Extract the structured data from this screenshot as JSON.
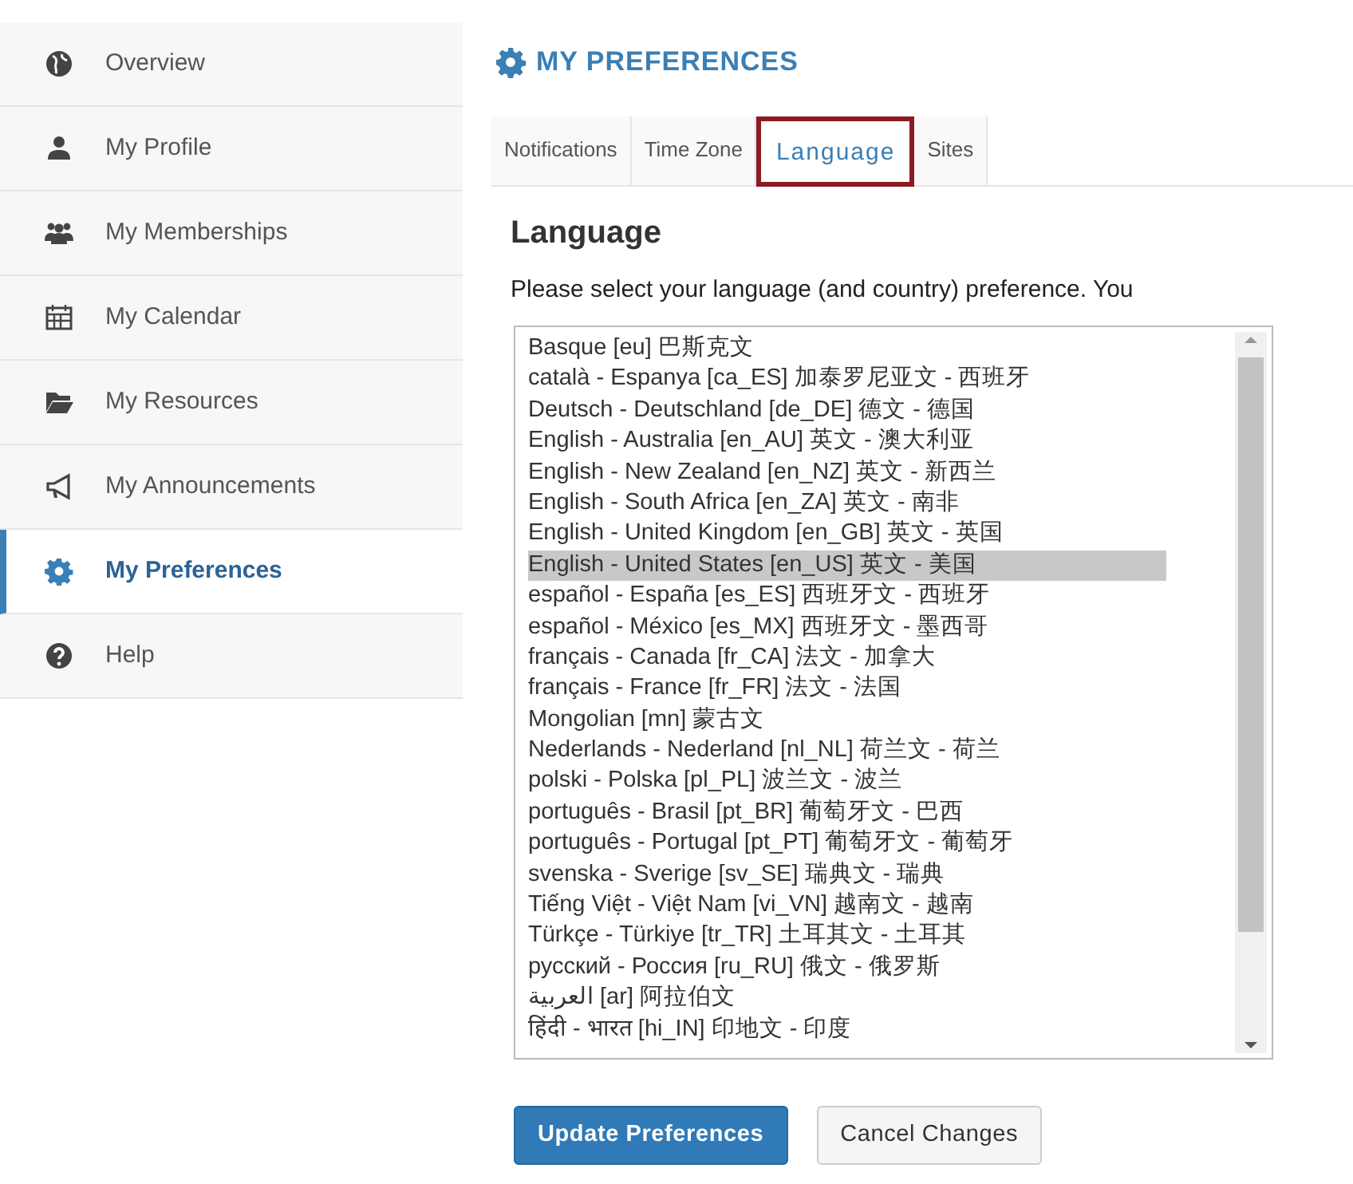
{
  "sidebar": {
    "items": [
      {
        "label": "Overview",
        "kind": "globe",
        "selected": false
      },
      {
        "label": "My Profile",
        "kind": "user",
        "selected": false
      },
      {
        "label": "My Memberships",
        "kind": "users",
        "selected": false
      },
      {
        "label": "My Calendar",
        "kind": "calendar",
        "selected": false
      },
      {
        "label": "My Resources",
        "kind": "folder",
        "selected": false
      },
      {
        "label": "My Announcements",
        "kind": "bullhorn",
        "selected": false
      },
      {
        "label": "My Preferences",
        "kind": "gear",
        "selected": true
      },
      {
        "label": "Help",
        "kind": "help",
        "selected": false
      }
    ]
  },
  "page_title": "MY PREFERENCES",
  "tabs": [
    {
      "label": "Notifications",
      "selected": false,
      "highlighted": false
    },
    {
      "label": "Time Zone",
      "selected": false,
      "highlighted": false
    },
    {
      "label": "Language",
      "selected": true,
      "highlighted": true
    },
    {
      "label": "Sites",
      "selected": false,
      "highlighted": false
    }
  ],
  "section_heading": "Language",
  "instructions": "Please select your language (and country) preference. You",
  "language_list": [
    {
      "label": "Basque [eu] 巴斯克文",
      "selected": false
    },
    {
      "label": "català - Espanya [ca_ES] 加泰罗尼亚文 - 西班牙",
      "selected": false
    },
    {
      "label": "Deutsch - Deutschland [de_DE] 德文 - 德国",
      "selected": false
    },
    {
      "label": "English - Australia [en_AU] 英文 - 澳大利亚",
      "selected": false
    },
    {
      "label": "English - New Zealand [en_NZ] 英文 - 新西兰",
      "selected": false
    },
    {
      "label": "English - South Africa [en_ZA] 英文 - 南非",
      "selected": false
    },
    {
      "label": "English - United Kingdom [en_GB] 英文 - 英国",
      "selected": false
    },
    {
      "label": "English - United States [en_US] 英文 - 美国",
      "selected": true
    },
    {
      "label": "español - España [es_ES] 西班牙文 - 西班牙",
      "selected": false
    },
    {
      "label": "español - México [es_MX] 西班牙文 - 墨西哥",
      "selected": false
    },
    {
      "label": "français - Canada [fr_CA] 法文 - 加拿大",
      "selected": false
    },
    {
      "label": "français - France [fr_FR] 法文 - 法国",
      "selected": false
    },
    {
      "label": "Mongolian [mn] 蒙古文",
      "selected": false
    },
    {
      "label": "Nederlands - Nederland [nl_NL] 荷兰文 - 荷兰",
      "selected": false
    },
    {
      "label": "polski - Polska [pl_PL] 波兰文 - 波兰",
      "selected": false
    },
    {
      "label": "português - Brasil [pt_BR] 葡萄牙文 - 巴西",
      "selected": false
    },
    {
      "label": "português - Portugal [pt_PT] 葡萄牙文 - 葡萄牙",
      "selected": false
    },
    {
      "label": "svenska - Sverige [sv_SE] 瑞典文 - 瑞典",
      "selected": false
    },
    {
      "label": "Tiếng Việt - Việt Nam [vi_VN] 越南文 - 越南",
      "selected": false
    },
    {
      "label": "Türkçe - Türkiye [tr_TR] 土耳其文 - 土耳其",
      "selected": false
    },
    {
      "label": "русский - Россия [ru_RU] 俄文 - 俄罗斯",
      "selected": false
    },
    {
      "label": "العربية [ar] 阿拉伯文",
      "selected": false
    },
    {
      "label": "हिंदी - भारत [hi_IN] 印地文 - 印度",
      "selected": false
    }
  ],
  "buttons": [
    {
      "label": "Update Preferences",
      "kind": "primary"
    },
    {
      "label": "Cancel Changes",
      "kind": "secondary"
    }
  ]
}
